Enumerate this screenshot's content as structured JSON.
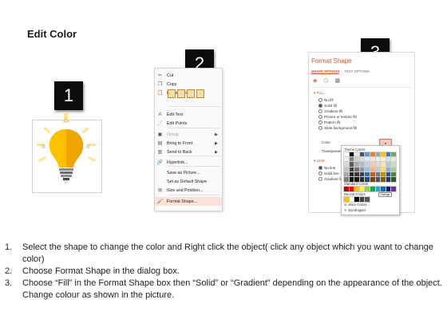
{
  "title": "Edit Color",
  "badges": [
    "1",
    "2",
    "3"
  ],
  "context_menu": {
    "items": [
      {
        "label": "Cut",
        "icon": "scissors-icon",
        "glyph": "✂",
        "disabled": false
      },
      {
        "label": "Copy",
        "icon": "copy-icon",
        "glyph": "❐",
        "disabled": false
      },
      {
        "label": "Paste Options:",
        "icon": "paste-icon",
        "glyph": "📋",
        "disabled": false
      },
      {
        "label": "Edit Text",
        "icon": "edit-text-icon",
        "glyph": "A",
        "disabled": false
      },
      {
        "label": "Edit Points",
        "icon": "edit-points-icon",
        "glyph": "⋰",
        "disabled": false
      },
      {
        "label": "Group",
        "icon": "group-icon",
        "glyph": "▣",
        "disabled": true,
        "submenu": true
      },
      {
        "label": "Bring to Front",
        "icon": "bring-front-icon",
        "glyph": "▤",
        "disabled": false,
        "submenu": true
      },
      {
        "label": "Send to Back",
        "icon": "send-back-icon",
        "glyph": "▥",
        "disabled": false,
        "submenu": true
      },
      {
        "label": "Hyperlink...",
        "icon": "hyperlink-icon",
        "glyph": "🔗",
        "disabled": false
      },
      {
        "label": "Save as Picture...",
        "icon": "",
        "glyph": "",
        "disabled": false
      },
      {
        "label": "Set as Default Shape",
        "icon": "",
        "glyph": "",
        "disabled": false
      },
      {
        "label": "Size and Position...",
        "icon": "size-position-icon",
        "glyph": "⊞",
        "disabled": false
      },
      {
        "label": "Format Shape...",
        "icon": "format-shape-icon",
        "glyph": "🖌",
        "disabled": false,
        "highlighted": true
      }
    ]
  },
  "format_pane": {
    "title": "Format Shape",
    "tabs": [
      "SHAPE OPTIONS",
      "TEXT OPTIONS"
    ],
    "fill_section": "FILL",
    "fill_options": [
      "No fill",
      "Solid fill",
      "Gradient fill",
      "Picture or texture fill",
      "Pattern fill",
      "Slide background fill"
    ],
    "fill_selected": 1,
    "color_label": "Color",
    "transparency_label": "Transparency",
    "line_section": "LINE",
    "line_options": [
      "No line",
      "Solid line",
      "Gradient line"
    ],
    "line_selected": 0
  },
  "color_picker": {
    "theme_label": "Theme Colors",
    "standard_label": "Standard Colors",
    "recent_label": "Recent Colors",
    "tooltip": "Orange",
    "more_colors": "More Colors...",
    "eyedropper": "Eyedropper",
    "theme_top": [
      "#ffffff",
      "#000000",
      "#e7e6e6",
      "#44546a",
      "#5b9bd5",
      "#ed7d31",
      "#a5a5a5",
      "#ffc000",
      "#4472c4",
      "#70ad47"
    ],
    "theme_shades": [
      [
        "#f2f2f2",
        "#7f7f7f",
        "#d0cece",
        "#d6dce4",
        "#deebf6",
        "#fbe5d5",
        "#ededed",
        "#fff2cc",
        "#d9e2f3",
        "#e2efd9"
      ],
      [
        "#d8d8d8",
        "#595959",
        "#aeabab",
        "#adb9ca",
        "#bdd7ee",
        "#f7cbac",
        "#dbdbdb",
        "#fee599",
        "#b4c6e7",
        "#c5e0b3"
      ],
      [
        "#bfbfbf",
        "#3f3f3f",
        "#757070",
        "#8496b0",
        "#9cc3e5",
        "#f4b183",
        "#c9c9c9",
        "#ffd965",
        "#8eaadb",
        "#a8d08d"
      ],
      [
        "#a5a5a5",
        "#262626",
        "#3a3838",
        "#323f4f",
        "#2e75b5",
        "#c55a11",
        "#7b7b7b",
        "#bf9000",
        "#2f5496",
        "#538135"
      ],
      [
        "#7f7f7f",
        "#0c0c0c",
        "#171616",
        "#222a35",
        "#1e4e79",
        "#843c0b",
        "#525252",
        "#7f6000",
        "#1f3864",
        "#375623"
      ]
    ],
    "standard": [
      "#c00000",
      "#ff0000",
      "#ffc000",
      "#ffff00",
      "#92d050",
      "#00b050",
      "#00b0f0",
      "#0070c0",
      "#002060",
      "#7030a0"
    ],
    "recent": [
      "#ffc000",
      "#ffffff",
      "#000000",
      "#404040",
      "#595959"
    ]
  },
  "bulb": {
    "color_left": "#ffc000",
    "color_right": "#f0a500",
    "ray_color": "#ffe28a"
  },
  "instructions": [
    {
      "num": "1.",
      "text": "Select the shape to change the color and Right click the object( click any object which you want to change color)"
    },
    {
      "num": "2.",
      "text": "Choose Format Shape in the dialog box."
    },
    {
      "num": "3.",
      "text": "Choose “Fill” in the Format Shape box then “Solid” or “Gradient” depending on the appearance of the object. Change colour as shown in the picture."
    }
  ]
}
